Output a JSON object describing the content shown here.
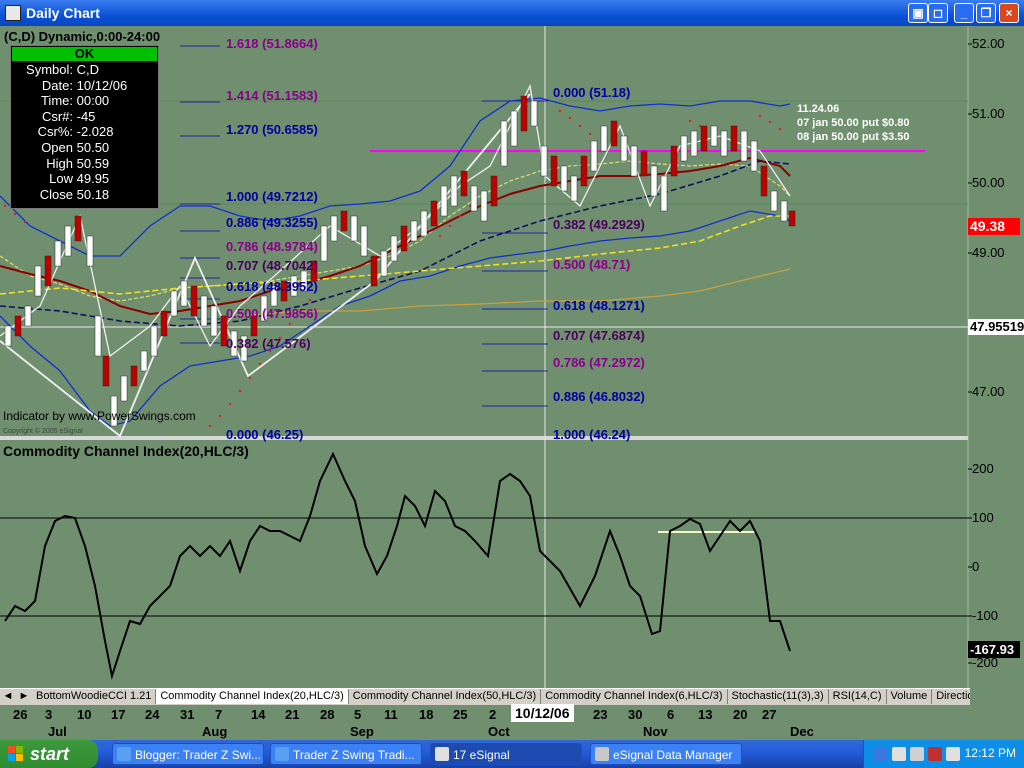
{
  "window": {
    "title": "Daily Chart",
    "buttons": [
      "_",
      "□",
      "×"
    ]
  },
  "chart": {
    "symbol_header": "(C,D) Dynamic,0:00-24:00",
    "indicator_credit": "Indicator by www.PowerSwings.com",
    "copyright": "Copyright © 2005 eSignal",
    "ohlc_box": {
      "status": "OK",
      "rows": [
        {
          "k": "Symbol:",
          "v": "C,D"
        },
        {
          "k": "Date:",
          "v": "10/12/06"
        },
        {
          "k": "Time:",
          "v": "00:00"
        },
        {
          "k": "Csr#:",
          "v": "-45"
        },
        {
          "k": "Csr%:",
          "v": "-2.028"
        },
        {
          "k": "Open",
          "v": "50.50"
        },
        {
          "k": "High",
          "v": "50.59"
        },
        {
          "k": "Low",
          "v": "49.95"
        },
        {
          "k": "Close",
          "v": "50.18"
        }
      ]
    },
    "price_axis": [
      "52.00",
      "51.00",
      "50.00",
      "49.00",
      "47.00"
    ],
    "last_price": "49.38",
    "cursor_price": "47.95519",
    "fib_left": [
      {
        "label": "1.618 (51.8664)",
        "color": "#8b008b"
      },
      {
        "label": "1.414 (51.1583)",
        "color": "#8b008b"
      },
      {
        "label": "1.270 (50.6585)",
        "color": "#0000a0"
      },
      {
        "label": "1.000 (49.7212)",
        "color": "#0000a0"
      },
      {
        "label": "0.886 (49.3255)",
        "color": "#0000a0"
      },
      {
        "label": "0.786 (48.9784)",
        "color": "#8b008b"
      },
      {
        "label": "0.707 (48.7042)",
        "color": "#4b0060"
      },
      {
        "label": "0.618 (48.3952)",
        "color": "#0000a0"
      },
      {
        "label": "0.500 (47.9856)",
        "color": "#8b008b"
      },
      {
        "label": "0.382 (47.576)",
        "color": "#4b0060"
      },
      {
        "label": "0.000 (46.25)",
        "color": "#0000a0"
      }
    ],
    "fib_right": [
      {
        "label": "0.000 (51.18)",
        "color": "#0000a0"
      },
      {
        "label": "0.382 (49.2929)",
        "color": "#4b0060"
      },
      {
        "label": "0.500 (48.71)",
        "color": "#8b008b"
      },
      {
        "label": "0.618 (48.1271)",
        "color": "#0000a0"
      },
      {
        "label": "0.707 (47.6874)",
        "color": "#4b0060"
      },
      {
        "label": "0.786 (47.2972)",
        "color": "#8b008b"
      },
      {
        "label": "0.886 (46.8032)",
        "color": "#0000a0"
      },
      {
        "label": "1.000 (46.24)",
        "color": "#0000a0"
      }
    ],
    "annotations": [
      "11.24.06",
      "07 jan 50.00 put $0.80",
      "08 jan 50.00 put $3.50"
    ]
  },
  "cci": {
    "title": "Commodity Channel Index(20,HLC/3)",
    "axis": [
      "200",
      "100",
      "0",
      "-100",
      "-200"
    ],
    "last_value": "-167.93"
  },
  "tabs": [
    "BottomWoodieCCI 1.21",
    "Commodity Channel Index(20,HLC/3)",
    "Commodity Channel Index(50,HLC/3)",
    "Commodity Channel Index(6,HLC/3)",
    "Stochastic(11(3),3)",
    "RSI(14,C)",
    "Volume",
    "Directiona"
  ],
  "dates": {
    "days": [
      "26",
      "3",
      "10",
      "17",
      "24",
      "31",
      "7",
      "14",
      "21",
      "28",
      "5",
      "11",
      "18",
      "25",
      "2",
      "23",
      "30",
      "6",
      "13",
      "20",
      "27"
    ],
    "months": [
      "Jul",
      "Aug",
      "Sep",
      "Oct",
      "Nov",
      "Dec"
    ],
    "cursor_date": "10/12/06"
  },
  "taskbar": {
    "start": "start",
    "tasks": [
      "Blogger: Trader Z Swi...",
      "Trader Z Swing Tradi...",
      "17 eSignal",
      "eSignal Data Manager"
    ],
    "clock": "12:12 PM"
  },
  "colors": {
    "chart_bg": "#6f8f6f",
    "up_candle": "#ffffff",
    "down_candle": "#c00000",
    "magenta_line": "#ff00ff"
  }
}
